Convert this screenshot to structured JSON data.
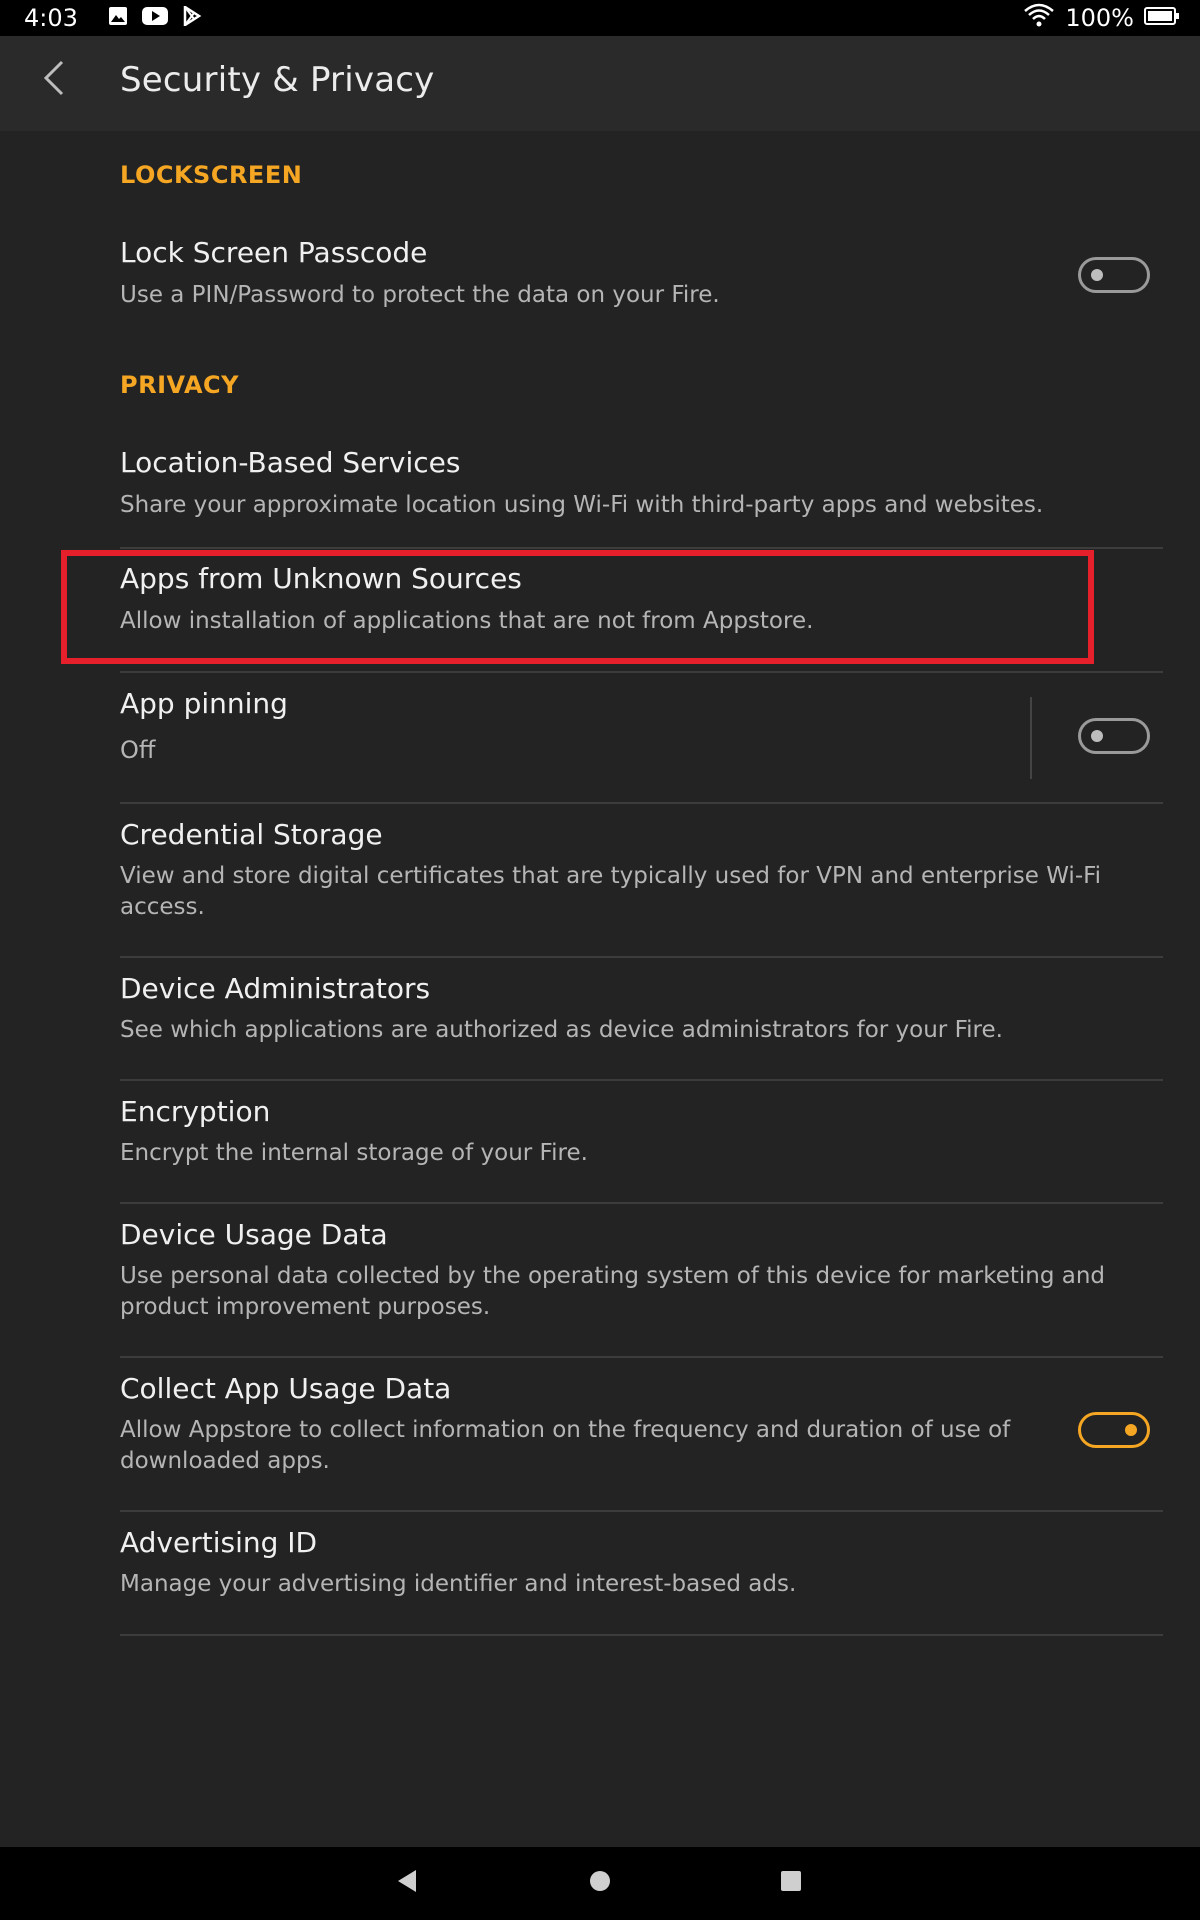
{
  "status_bar": {
    "time": "4:03",
    "battery_percent": "100%",
    "left_icons": [
      "image-icon",
      "youtube-icon",
      "play-store-icon"
    ],
    "right_icons": [
      "wifi-icon",
      "battery-icon"
    ]
  },
  "app_bar": {
    "title": "Security & Privacy",
    "back_icon": "chevron-left-icon"
  },
  "sections": {
    "lockscreen": "LOCKSCREEN",
    "privacy": "PRIVACY"
  },
  "items": {
    "lock_screen_passcode": {
      "title": "Lock Screen Passcode",
      "subtitle": "Use a PIN/Password to protect the data on your Fire.",
      "toggle_on": false
    },
    "location_services": {
      "title": "Location-Based Services",
      "subtitle": "Share your approximate location using Wi-Fi with third-party apps and websites."
    },
    "unknown_sources": {
      "title": "Apps from Unknown Sources",
      "subtitle": "Allow installation of applications that are not from Appstore."
    },
    "app_pinning": {
      "title": "App pinning",
      "subtitle": "Off",
      "toggle_on": false
    },
    "credential_storage": {
      "title": "Credential Storage",
      "subtitle": "View and store digital certificates that are typically used for VPN and enterprise Wi-Fi access."
    },
    "device_administrators": {
      "title": "Device Administrators",
      "subtitle": "See which applications are authorized as device administrators for your Fire."
    },
    "encryption": {
      "title": "Encryption",
      "subtitle": "Encrypt the internal storage of your Fire."
    },
    "device_usage_data": {
      "title": "Device Usage Data",
      "subtitle": "Use personal data collected by the operating system of this device for marketing and product improvement purposes."
    },
    "collect_app_usage": {
      "title": "Collect App Usage Data",
      "subtitle": "Allow Appstore to collect information on the frequency and duration of use of downloaded apps.",
      "toggle_on": true
    },
    "advertising_id": {
      "title": "Advertising ID",
      "subtitle": "Manage your advertising identifier and interest-based ads."
    }
  },
  "nav_bar": {
    "icons": [
      "back-triangle-icon",
      "home-circle-icon",
      "recents-square-icon"
    ]
  },
  "colors": {
    "accent": "#f5a623",
    "highlight": "#e5202a",
    "background": "#232323",
    "app_bar": "#2a2a2a"
  }
}
